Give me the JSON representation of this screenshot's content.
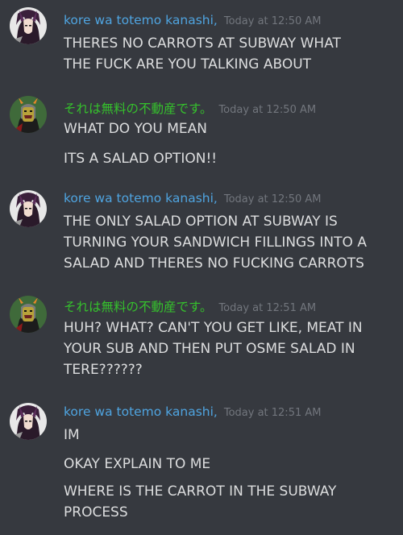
{
  "messages": [
    {
      "username": "kore wa totemo kanashi,",
      "timestamp": "Today at 12:50 AM",
      "avatar_icon": "anime-character-avatar-icon",
      "lines": [
        "THERES NO CARROTS AT SUBWAY WHAT",
        "THE FUCK ARE YOU TALKING ABOUT"
      ]
    },
    {
      "username": "それは無料の不動産です。",
      "timestamp": "Today at 12:50 AM",
      "avatar_icon": "troll-character-avatar-icon",
      "lines": [
        "WHAT DO YOU MEAN",
        "ITS A SALAD OPTION!!"
      ]
    },
    {
      "username": "kore wa totemo kanashi,",
      "timestamp": "Today at 12:50 AM",
      "avatar_icon": "anime-character-avatar-icon",
      "lines": [
        "THE ONLY SALAD OPTION AT SUBWAY IS",
        "TURNING YOUR SANDWICH FILLINGS INTO A",
        "SALAD AND THERES NO FUCKING CARROTS"
      ]
    },
    {
      "username": "それは無料の不動産です。",
      "timestamp": "Today at 12:51 AM",
      "avatar_icon": "troll-character-avatar-icon",
      "lines": [
        "HUH? WHAT? CAN'T YOU GET LIKE, MEAT IN",
        "YOUR SUB AND THEN PUT OSME SALAD IN",
        "TERE??????"
      ]
    },
    {
      "username": "kore wa totemo kanashi,",
      "timestamp": "Today at 12:51 AM",
      "avatar_icon": "anime-character-avatar-icon",
      "lines": [
        "IM",
        "OKAY EXPLAIN TO ME",
        "WHERE IS THE CARROT IN THE SUBWAY",
        "PROCESS"
      ]
    }
  ],
  "colors": {
    "background": "#36393f",
    "username_blue": "#4fa4e0",
    "username_green": "#35c12c",
    "timestamp": "#72767d",
    "text": "#dcddde"
  }
}
